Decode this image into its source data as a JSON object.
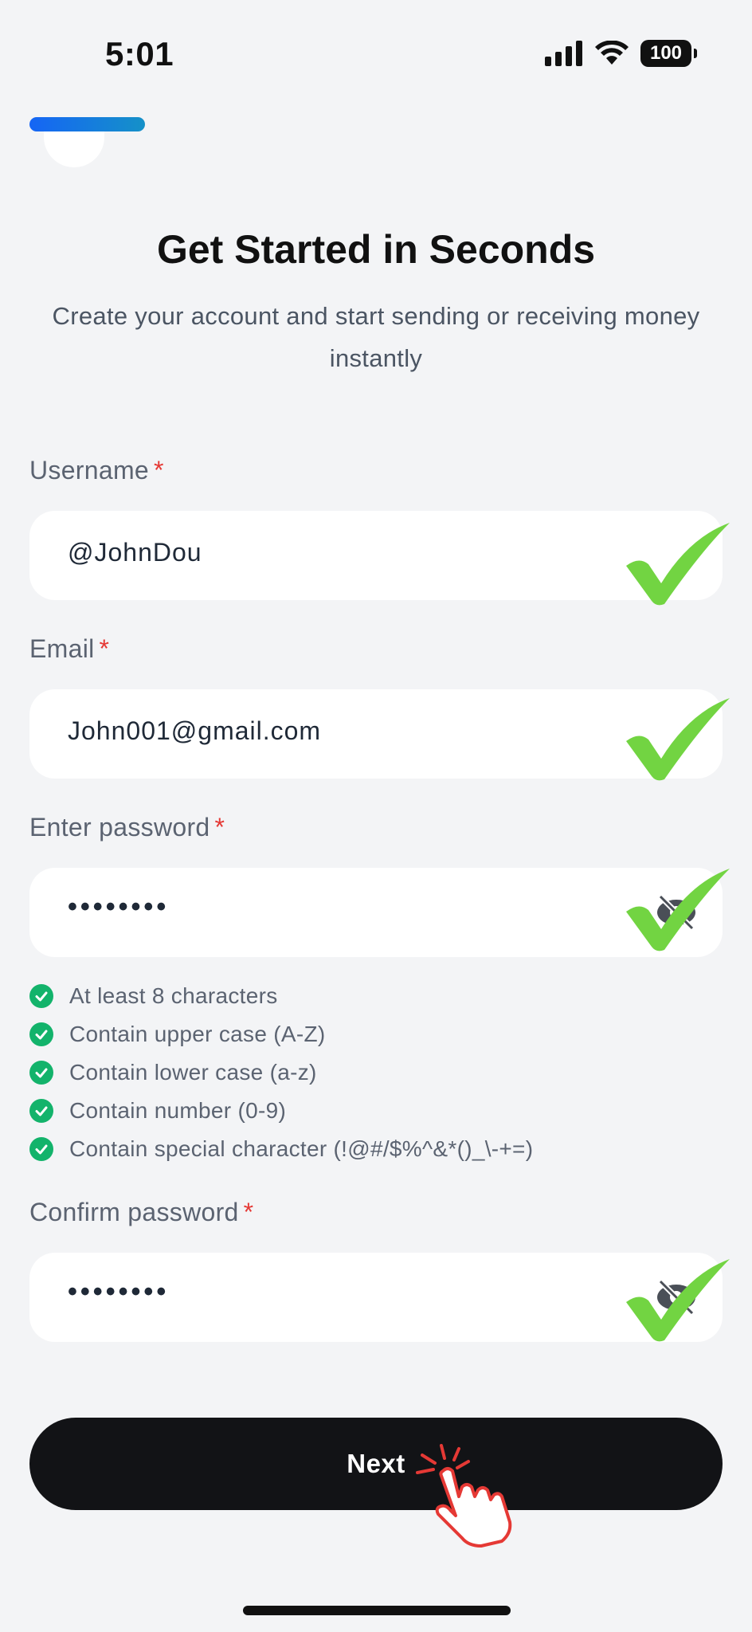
{
  "status_bar": {
    "time": "5:01",
    "battery": "100"
  },
  "header": {
    "title": "Get Started in Seconds",
    "subtitle": "Create your account and start sending or receiving money instantly"
  },
  "form": {
    "username": {
      "label": "Username",
      "required_mark": "*",
      "value": "@JohnDou"
    },
    "email": {
      "label": "Email",
      "required_mark": "*",
      "value": "John001@gmail.com"
    },
    "password": {
      "label": "Enter password",
      "required_mark": "*",
      "value": "••••••••"
    },
    "confirm_password": {
      "label": "Confirm password",
      "required_mark": "*",
      "value": "••••••••"
    }
  },
  "password_requirements": [
    {
      "text": "At least 8 characters",
      "met": true
    },
    {
      "text": "Contain upper case (A-Z)",
      "met": true
    },
    {
      "text": "Contain lower case (a-z)",
      "met": true
    },
    {
      "text": "Contain number (0-9)",
      "met": true
    },
    {
      "text": "Contain special character (!@#/$%^&*()_\\-+=)",
      "met": true
    }
  ],
  "actions": {
    "next_label": "Next"
  },
  "colors": {
    "accent_gradient": [
      "#1565f5",
      "#1591c8"
    ],
    "success": "#13b36b",
    "check_overlay": "#72d442",
    "required": "#e53935",
    "button": "#121316"
  }
}
